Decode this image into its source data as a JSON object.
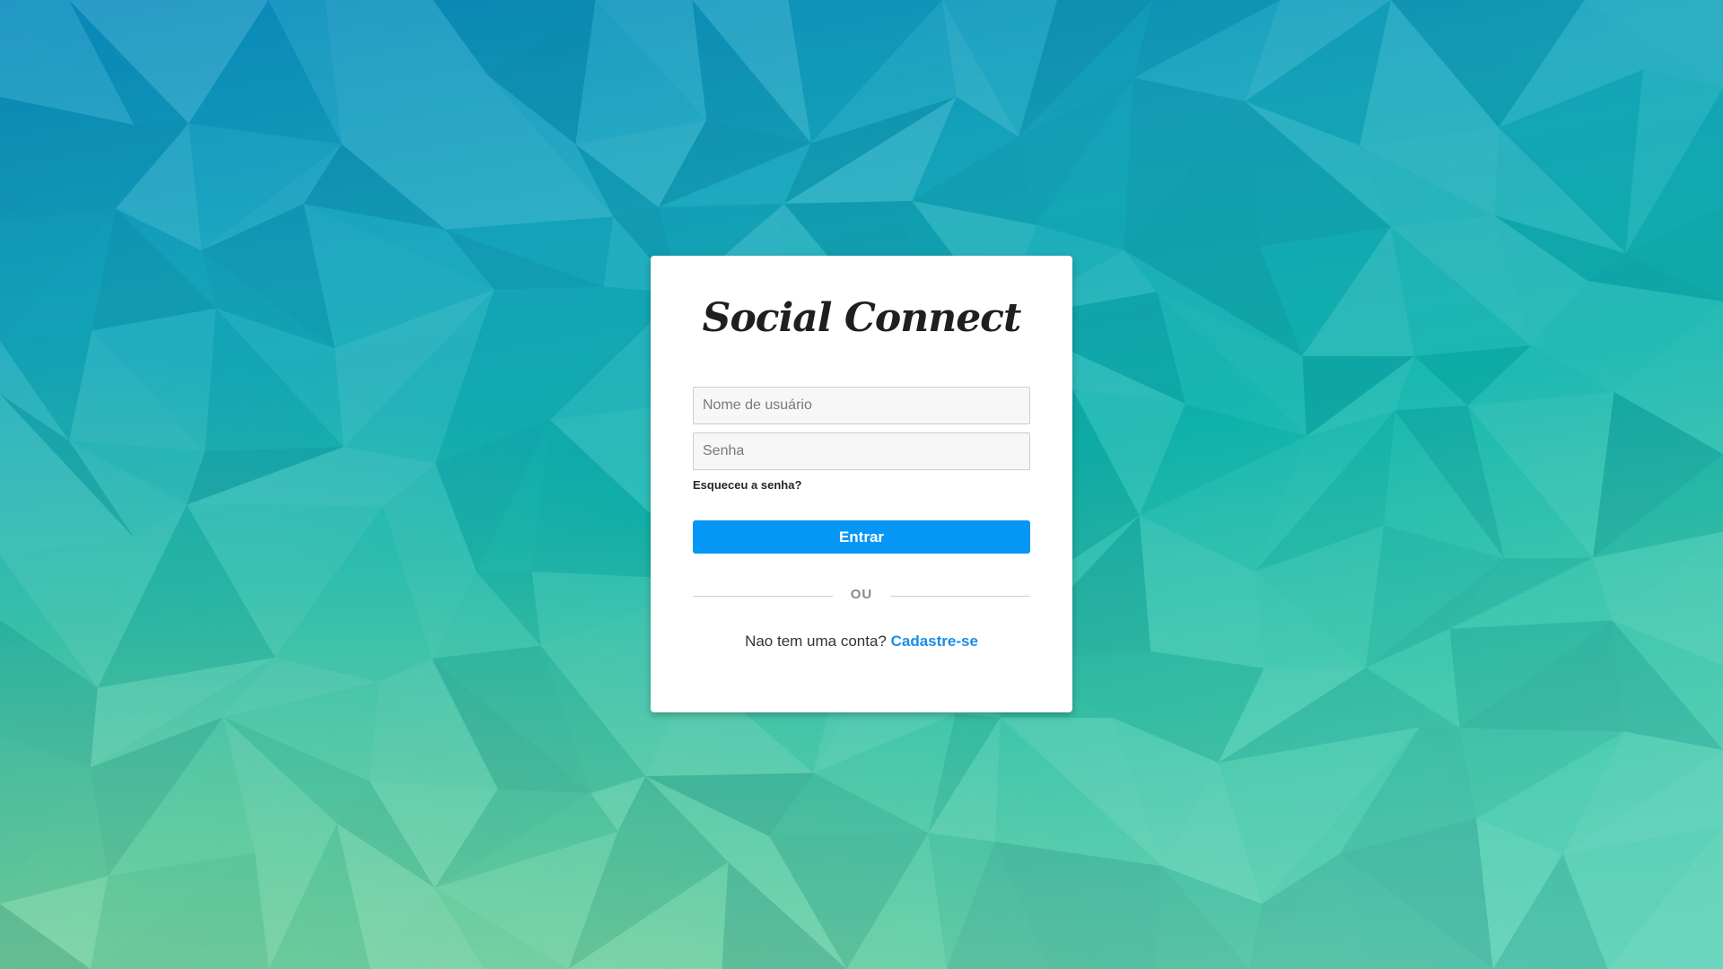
{
  "app": {
    "title": "Social Connect"
  },
  "login_form": {
    "username_placeholder": "Nome de usuário",
    "password_placeholder": "Senha",
    "forgot_password_label": "Esqueceu a senha?",
    "submit_label": "Entrar",
    "divider_label": "OU",
    "signup_prompt": "Nao tem uma conta?",
    "signup_link_label": "Cadastre-se"
  },
  "colors": {
    "primary_button": "#0596f6",
    "link": "#1a8fe3",
    "card_background": "#ffffff",
    "background_top": "#0a8cbf",
    "background_middle": "#10b5ad",
    "background_bottom": "#8fd6a0"
  }
}
